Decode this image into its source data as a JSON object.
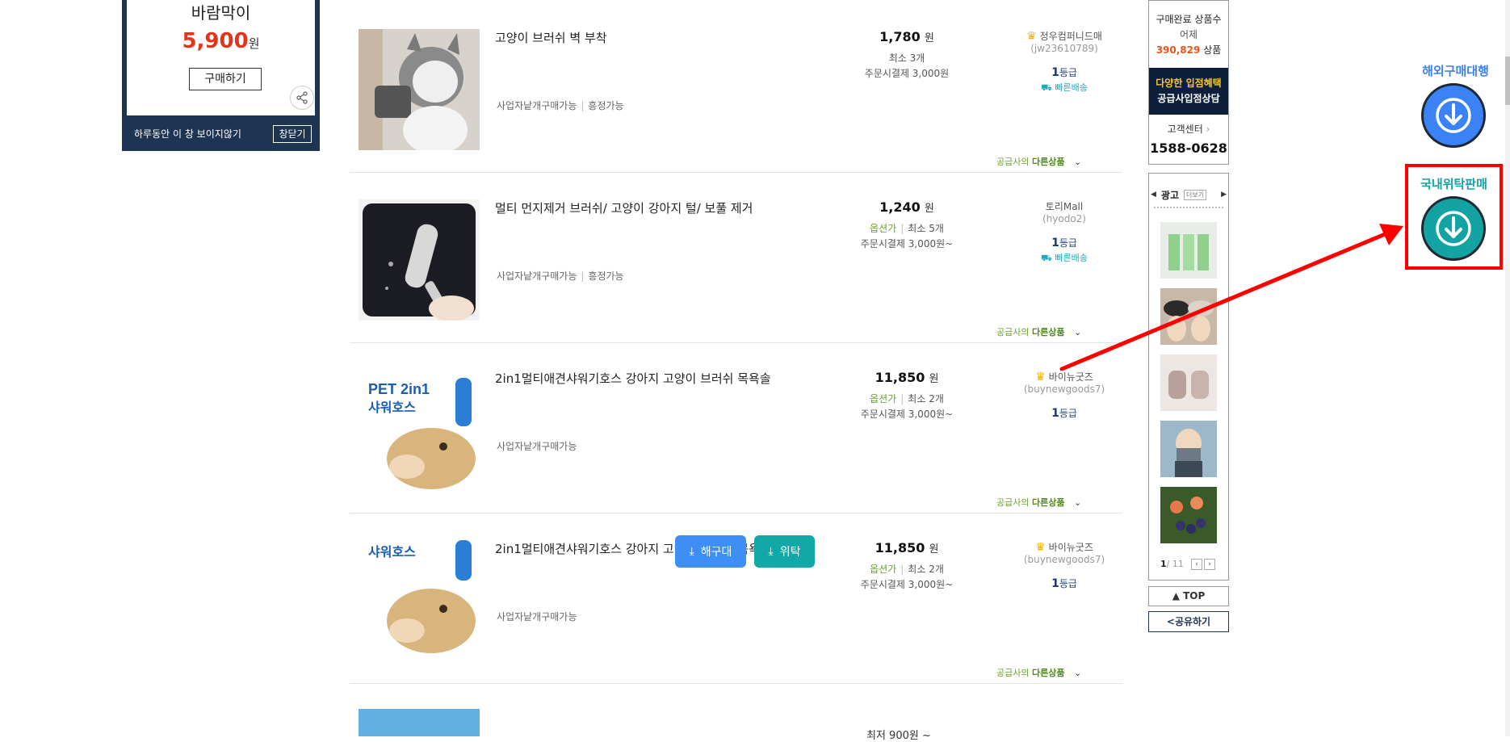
{
  "popup": {
    "product_name": "바람막이",
    "price": "5,900",
    "won": "원",
    "buy_label": "구매하기",
    "hide_today": "하루동안 이 창 보이지않기",
    "close_label": "창닫기"
  },
  "products": [
    {
      "title": "고양이 브러쉬 벽 부착",
      "tags": [
        "사업자낱개구매가능",
        "흥정가능"
      ],
      "price": "1,780",
      "won": "원",
      "option_label": "",
      "min_qty": "최소 3개",
      "shipping": "주문시결제 3,000원",
      "seller_name": "정우컴퍼니드매",
      "seller_id": "(jw23610789)",
      "grade_num": "1",
      "grade_label": "등급",
      "fast_label": "빠른배송",
      "other_prefix": "공급사의",
      "other_label": "다른상품"
    },
    {
      "title": "멀티 먼지제거 브러쉬/ 고양이 강아지 털/ 보풀 제거",
      "tags": [
        "사업자낱개구매가능",
        "흥정가능"
      ],
      "price": "1,240",
      "won": "원",
      "option_label": "옵션가",
      "min_qty": "최소 5개",
      "shipping": "주문시결제 3,000원~",
      "seller_name": "토리Mall",
      "seller_id": "(hyodo2)",
      "grade_num": "1",
      "grade_label": "등급",
      "fast_label": "빠른배송",
      "other_prefix": "공급사의",
      "other_label": "다른상품"
    },
    {
      "title": "2in1멀티애견샤워기호스 강아지 고양이 브러쉬 목욕솔",
      "tags": [
        "사업자낱개구매가능"
      ],
      "price": "11,850",
      "won": "원",
      "option_label": "옵션가",
      "min_qty": "최소 2개",
      "shipping": "주문시결제 3,000원~",
      "seller_name": "바이뉴굿즈",
      "seller_id": "(buynewgoods7)",
      "grade_num": "1",
      "grade_label": "등급",
      "fast_label": "",
      "other_prefix": "공급사의",
      "other_label": "다른상품",
      "thumb_text": "PET 2in1 샤워호스"
    },
    {
      "title": "2in1멀티애견샤워기호스 강아지 고양이 브러쉬 목욕솔",
      "tags": [
        "사업자낱개구매가능"
      ],
      "price": "11,850",
      "won": "원",
      "option_label": "옵션가",
      "min_qty": "최소 2개",
      "shipping": "주문시결제 3,000원~",
      "seller_name": "바이뉴굿즈",
      "seller_id": "(buynewgoods7)",
      "grade_num": "1",
      "grade_label": "등급",
      "fast_label": "",
      "other_prefix": "공급사의",
      "other_label": "다른상품",
      "thumb_text": "샤워호스"
    }
  ],
  "partial_row": {
    "price_text": "최저 900원 ~"
  },
  "floating": {
    "overseas_btn": "해구대",
    "consign_btn": "위탁",
    "overseas_color": "#3d8ef5",
    "consign_color": "#12a8a8"
  },
  "sidebar": {
    "sold_label": "구매완료 상품수",
    "yesterday": "어제",
    "sold_count": "390,829",
    "sold_unit": "상품",
    "banner_line1": "다양한 입점혜택",
    "banner_line2": "공급사입점상담",
    "cs_label": "고객센터",
    "phone": "1588-0628",
    "ad_label": "광고",
    "ad_more": "더보기",
    "page_current": "1",
    "page_total": "/ 11",
    "top_label": "▲ TOP",
    "share_label": "공유하기"
  },
  "far_right": {
    "overseas_label": "해외구매대행",
    "consign_label": "국내위탁판매",
    "overseas_color": "#3b82f6",
    "consign_color": "#14a3a3",
    "highlight_color": "#ff0000"
  }
}
